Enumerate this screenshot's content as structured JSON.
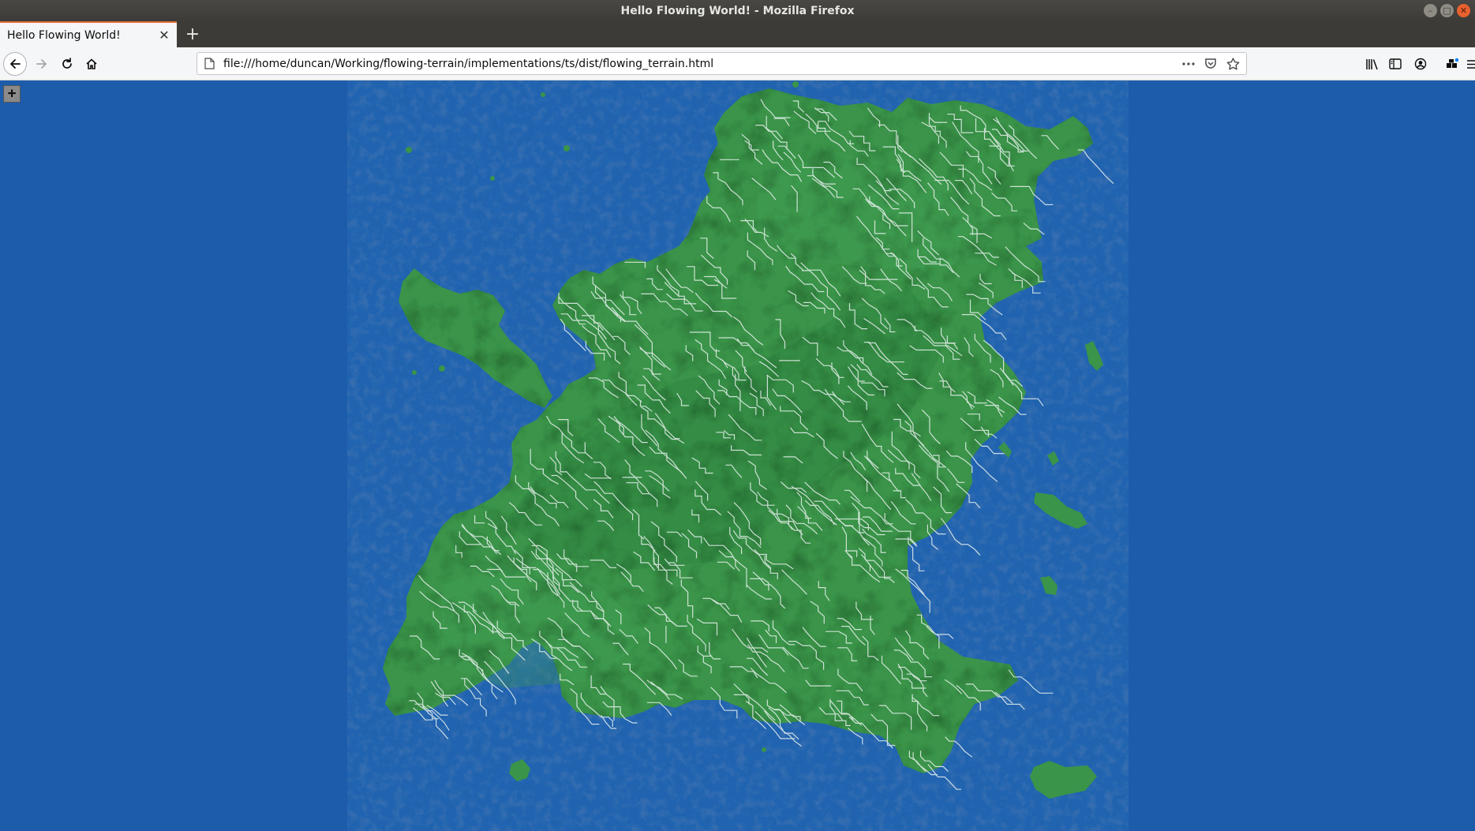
{
  "window": {
    "title": "Hello Flowing World! - Mozilla Firefox",
    "minimize_icon": "minimize-icon",
    "maximize_icon": "maximize-icon",
    "close_icon": "close-icon"
  },
  "tabs": [
    {
      "label": "Hello Flowing World!",
      "active": true
    }
  ],
  "new_tab_symbol": "+",
  "navbar": {
    "url": "file:///home/duncan/Working/flowing-terrain/implementations/ts/dist/flowing_terrain.html",
    "page_icon": "page-icon",
    "actions_icon": "more-actions-icon",
    "pocket_icon": "pocket-icon",
    "bookmark_icon": "star-icon"
  },
  "toolbar_icons": [
    "library-icon",
    "sidebar-icon",
    "account-icon",
    "extensions-icon",
    "menu-icon"
  ],
  "content": {
    "zoom_button_symbol": "+",
    "colors": {
      "water": "#1c5cab",
      "land": "#3a9449",
      "land_dark": "#2e7a3c",
      "river": "#e8f1ee"
    }
  }
}
